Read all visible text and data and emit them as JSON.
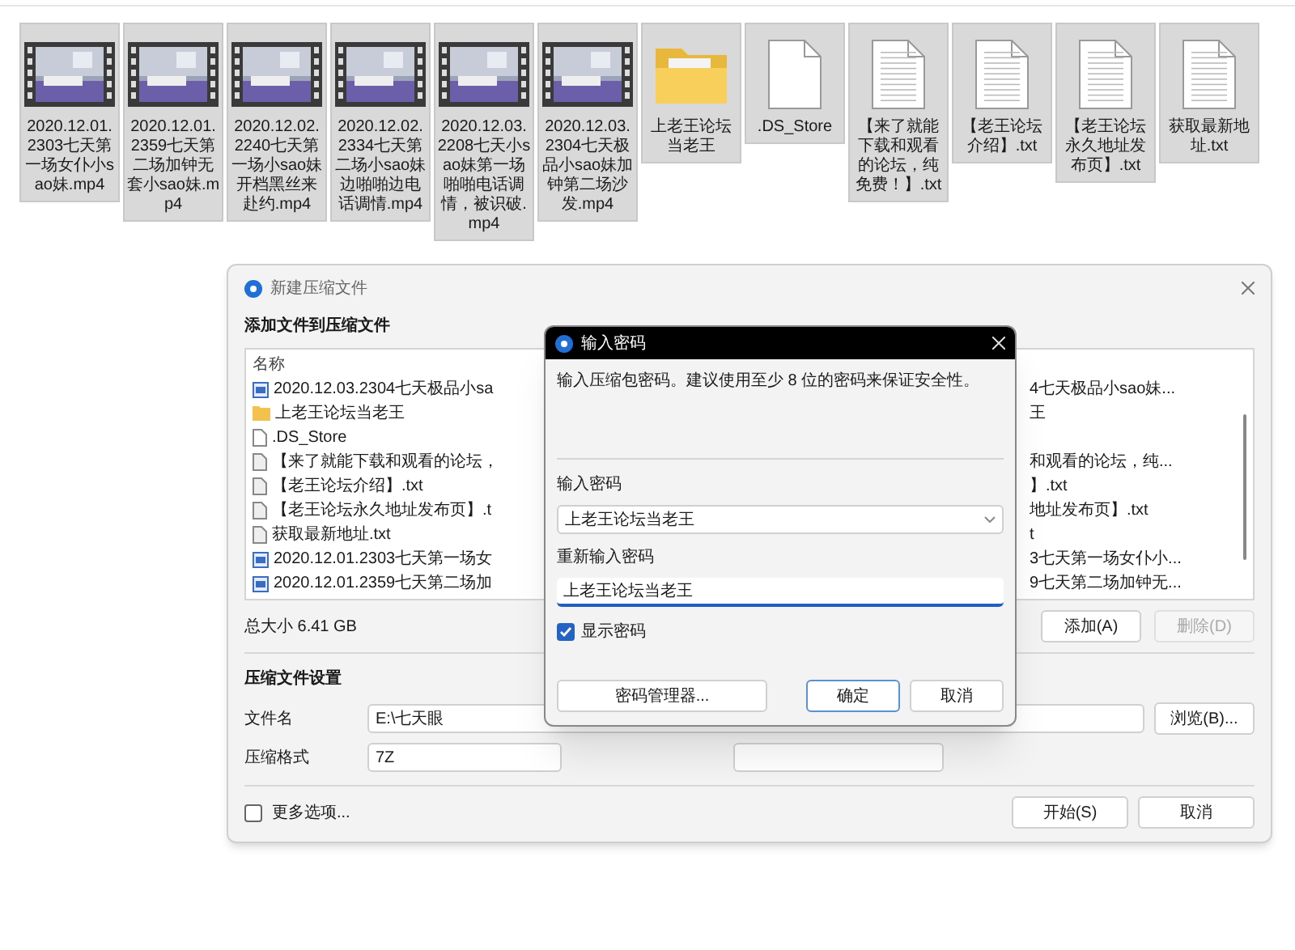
{
  "files": [
    {
      "name": "2020.12.01.2303七天第一场女仆小sao妹.mp4",
      "kind": "video"
    },
    {
      "name": "2020.12.01.2359七天第二场加钟无套小sao妹.mp4",
      "kind": "video"
    },
    {
      "name": "2020.12.02.2240七天第一场小sao妹开档黑丝来赴约.mp4",
      "kind": "video"
    },
    {
      "name": "2020.12.02.2334七天第二场小sao妹边啪啪边电话调情.mp4",
      "kind": "video"
    },
    {
      "name": "2020.12.03.2208七天小sao妹第一场啪啪电话调情，被识破.mp4",
      "kind": "video"
    },
    {
      "name": "2020.12.03.2304七天极品小sao妹加钟第二场沙发.mp4",
      "kind": "video"
    },
    {
      "name": "上老王论坛当老王",
      "kind": "folder"
    },
    {
      "name": ".DS_Store",
      "kind": "blank"
    },
    {
      "name": "【来了就能下载和观看的论坛，纯免费！】.txt",
      "kind": "text"
    },
    {
      "name": "【老王论坛介绍】.txt",
      "kind": "text"
    },
    {
      "name": "【老王论坛永久地址发布页】.txt",
      "kind": "text"
    },
    {
      "name": "获取最新地址.txt",
      "kind": "text"
    }
  ],
  "dialog": {
    "title": "新建压缩文件",
    "heading": "添加文件到压缩文件",
    "column": "名称",
    "rows": [
      {
        "left": "2020.12.03.2304七天极品小sa",
        "right": "4七天极品小sao妹...",
        "kind": "video"
      },
      {
        "left": "上老王论坛当老王",
        "right": "王",
        "kind": "folder"
      },
      {
        "left": ".DS_Store",
        "kind": "blank"
      },
      {
        "left": "【来了就能下载和观看的论坛，",
        "right": "和观看的论坛，纯...",
        "kind": "text"
      },
      {
        "left": "【老王论坛介绍】.txt",
        "right": "】.txt",
        "kind": "text"
      },
      {
        "left": "【老王论坛永久地址发布页】.t",
        "right": "地址发布页】.txt",
        "kind": "text"
      },
      {
        "left": "获取最新地址.txt",
        "right": "t",
        "kind": "text"
      },
      {
        "left": "2020.12.01.2303七天第一场女",
        "right": "3七天第一场女仆小...",
        "kind": "video"
      },
      {
        "left": "2020.12.01.2359七天第二场加",
        "right": "9七天第二场加钟无...",
        "kind": "video"
      }
    ],
    "total": "总大小 6.41 GB",
    "add_button": "添加(A)",
    "delete_button": {
      "label": "删除(D)",
      "disabled": true
    },
    "settings_heading": "压缩文件设置",
    "filename_label": "文件名",
    "filename_value": "E:\\七天眼",
    "browse_button": "浏览(B)...",
    "format_label": "压缩格式",
    "format_value": "7Z",
    "more_options": {
      "label": "更多选项...",
      "checked": false
    },
    "start_button": "开始(S)",
    "cancel_button": "取消"
  },
  "password_dialog": {
    "title": "输入密码",
    "description": "输入压缩包密码。建议使用至少 8 位的密码来保证安全性。",
    "password_label": "输入密码",
    "password_value": "上老王论坛当老王",
    "confirm_label": "重新输入密码",
    "confirm_value": "上老王论坛当老王",
    "show_password": {
      "label": "显示密码",
      "checked": true
    },
    "manager_button": "密码管理器...",
    "ok_button": "确定",
    "cancel_button": "取消"
  }
}
